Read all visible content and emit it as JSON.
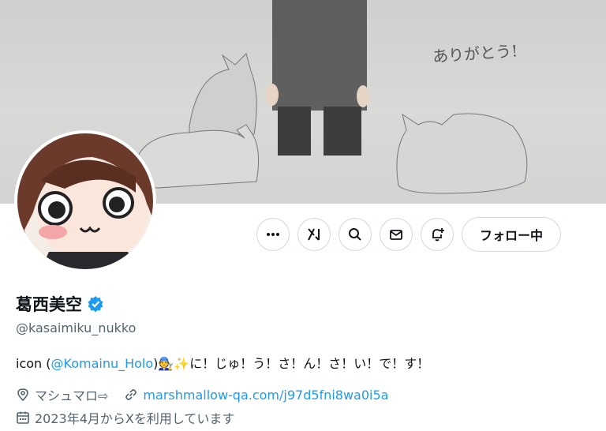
{
  "banner": {
    "caption": "ありがとう!"
  },
  "actions": {
    "more_icon": "more-icon",
    "grok_icon": "grok-icon",
    "search_icon": "search-icon",
    "message_icon": "message-icon",
    "notify_icon": "notification-add-icon",
    "follow_label": "フォロー中"
  },
  "profile": {
    "name": "葛西美空",
    "verified": true,
    "handle": "@kasaimiku_nukko",
    "bio_prefix": "icon (",
    "bio_mention": "@Komainu_Holo",
    "bio_suffix": ")🧑‍🔧✨に！じゅ！う！さ！ん！さ！い！で！す！",
    "location": "マシュマロ⇨",
    "website": "marshmallow-qa.com/j97d5fni8wa0i5a",
    "joined": "2023年4月からXを利用しています"
  },
  "colors": {
    "accent": "#1d9bf0",
    "secondary_text": "#536471",
    "border": "#cfd9de"
  }
}
